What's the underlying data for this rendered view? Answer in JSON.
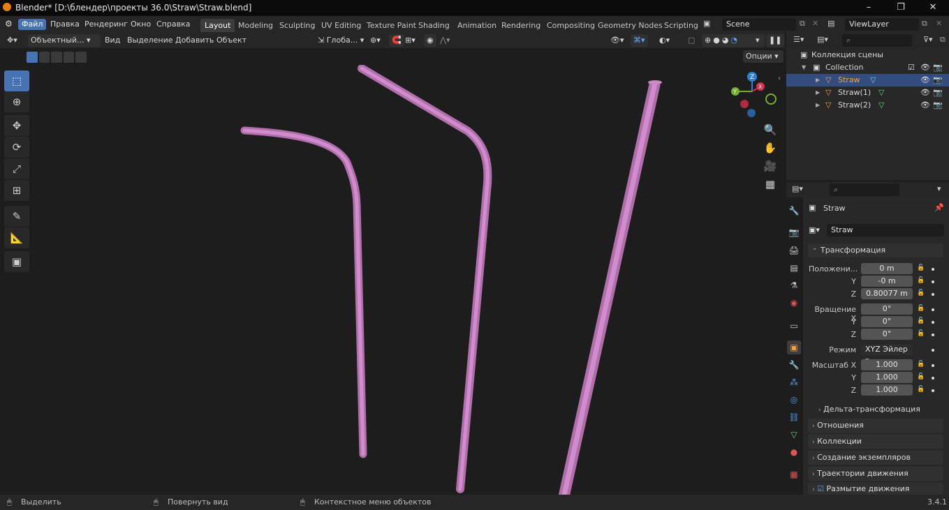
{
  "window": {
    "title": "Blender* [D:\\блендер\\проекты 36.0\\Straw\\Straw.blend]"
  },
  "menus": [
    "Файл",
    "Правка",
    "Рендеринг",
    "Окно",
    "Справка"
  ],
  "workspaces": [
    "Layout",
    "Modeling",
    "Sculpting",
    "UV Editing",
    "Texture Paint",
    "Shading",
    "Animation",
    "Rendering",
    "Compositing",
    "Geometry Nodes",
    "Scripting"
  ],
  "scene": {
    "scene_name": "Scene",
    "view_layer": "ViewLayer"
  },
  "viewport_header": {
    "mode": "Объектный...",
    "menus": [
      "Вид",
      "Выделение",
      "Добавить",
      "Объект"
    ],
    "orientation": "Глоба...",
    "options": "Опции"
  },
  "outliner": {
    "root": "Коллекция сцены",
    "collection": "Collection",
    "items": [
      "Straw",
      "Straw(1)",
      "Straw(2)"
    ]
  },
  "properties": {
    "object_name": "Straw",
    "object_field": "Straw",
    "transform_panel": "Трансформация",
    "location_label": "Положени...",
    "location": [
      "0 m",
      "-0 m",
      "0.80077 m"
    ],
    "rotation_label": "Вращение X",
    "rotation": [
      "0°",
      "0°",
      "0°"
    ],
    "mode_label": "Режим",
    "mode_value": "XYZ Эйлер",
    "scale_label": "Масштаб X",
    "scale": [
      "1.000",
      "1.000",
      "1.000"
    ],
    "axis_y": "Y",
    "axis_z": "Z",
    "delta": "Дельта-трансформация",
    "panels": [
      "Отношения",
      "Коллекции",
      "Создание экземпляров",
      "Траектории движения"
    ],
    "motion_blur": "Размытие движения"
  },
  "status": {
    "select": "Выделить",
    "rotate": "Повернуть вид",
    "context": "Контекстное меню объектов",
    "version": "3.4.1"
  },
  "colors": {
    "accent": "#4772b3",
    "straw": "#c77fc0",
    "selected_row": "#334d80"
  }
}
